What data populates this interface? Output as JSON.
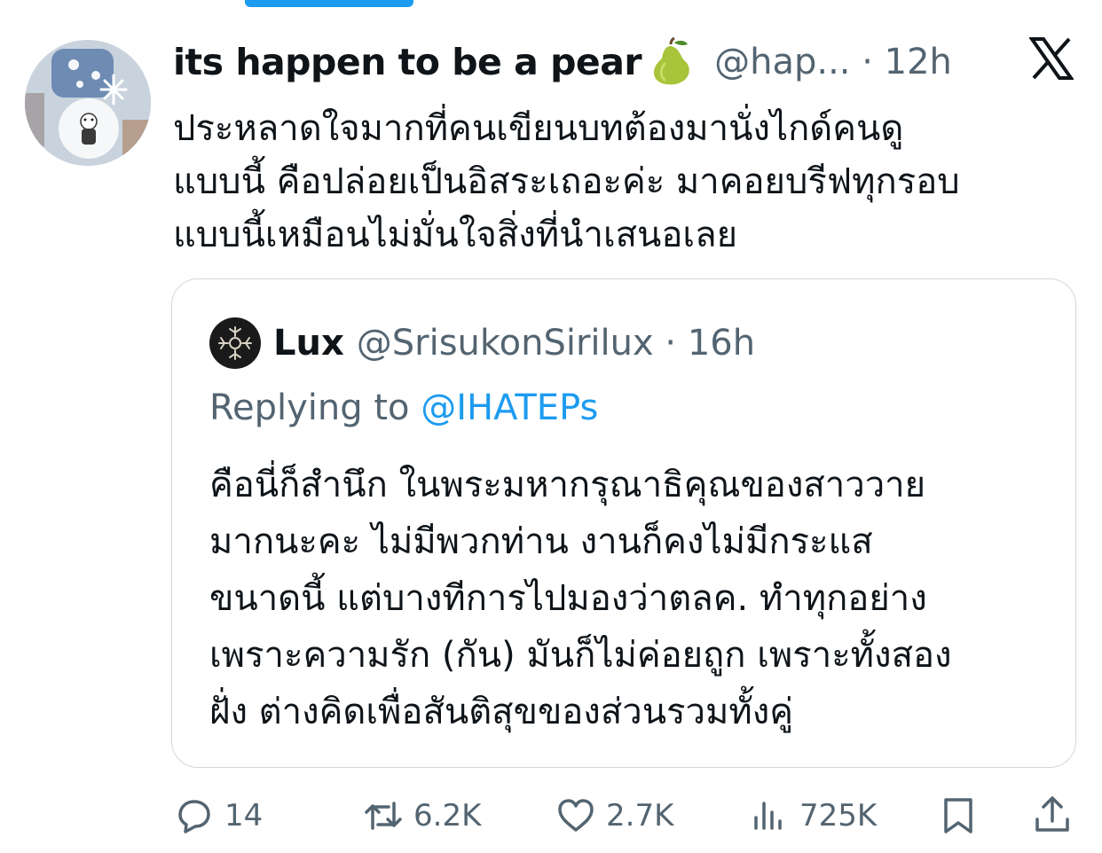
{
  "tweet": {
    "display_name": "its happen to be a pear",
    "handle_time": "@hap... · 12h",
    "text": "ประหลาดใจมากที่คนเขียนบทต้องมานั่งไกด์คนดู\nแบบนี้ คือปล่อยเป็นอิสระเถอะค่ะ มาคอยบรีฟทุกรอบ\nแบบนี้เหมือนไม่มั่นใจสิ่งที่นำเสนอเลย",
    "emoji": "pear",
    "platform_icon": "x-logo-icon"
  },
  "quote": {
    "name": "Lux",
    "handle_time": "@SrisukonSirilux · 16h",
    "replying_prefix": "Replying to",
    "replying_mention": "@IHATEPs",
    "text": "คือนี่ก็สำนึก ในพระมหากรุณาธิคุณของสาววาย\nมากนะคะ ไม่มีพวกท่าน งานก็คงไม่มีกระแส\nขนาดนี้ แต่บางทีการไปมองว่าตลค. ทำทุกอย่าง\nเพราะความรัก (กัน) มันก็ไม่ค่อยถูก เพราะทั้งสอง\nฝั่ง ต่างคิดเพื่อสันติสุขของส่วนรวมทั้งคู่"
  },
  "actions": {
    "replies": "14",
    "reposts": "6.2K",
    "likes": "2.7K",
    "views": "725K"
  },
  "colors": {
    "accent": "#1d9bf0",
    "secondary_text": "#536471",
    "border": "#cfd9de"
  }
}
